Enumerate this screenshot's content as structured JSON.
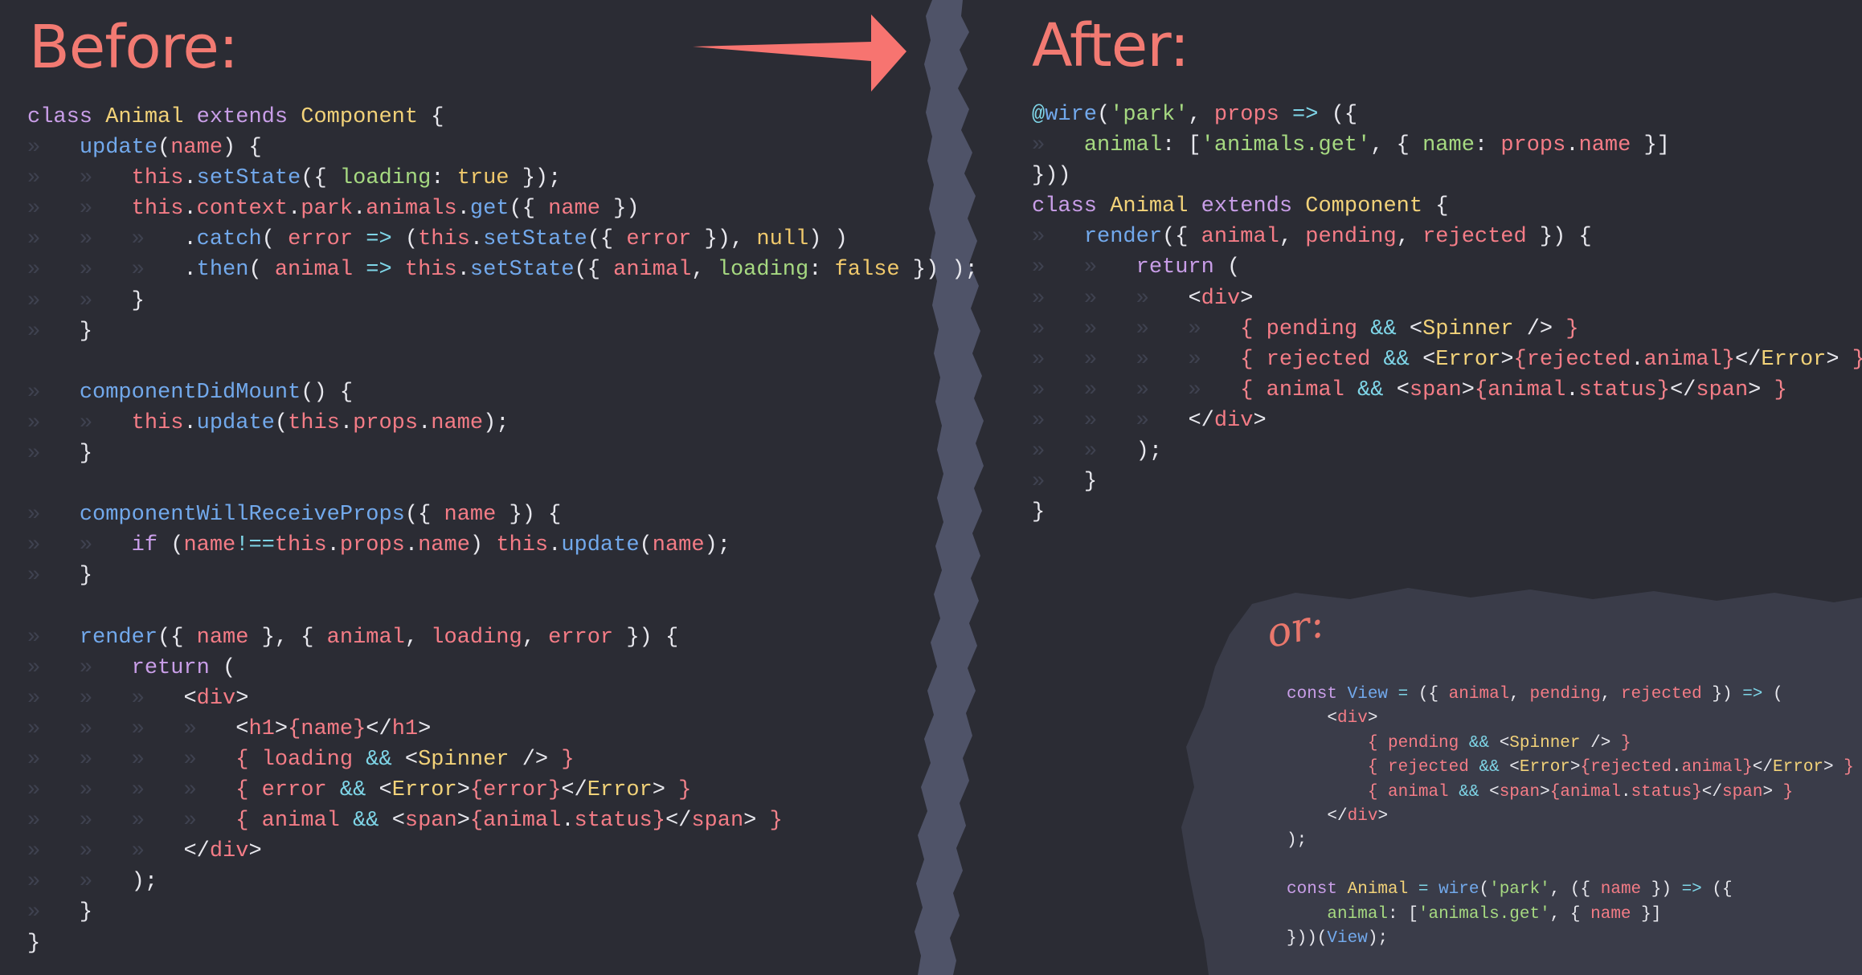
{
  "headings": {
    "before": "Before:",
    "after": "After:",
    "or": "or:"
  },
  "colors": {
    "background": "#2b2c34",
    "tear_strip": "#4f5368",
    "alt_panel": "#3a3c49",
    "heading": "#f27a72",
    "arrow": "#f77470",
    "keyword": "#c99ee8",
    "function": "#72a9ec",
    "class_name": "#f2d279",
    "parameter": "#f47c86",
    "string": "#a6d981",
    "operator": "#7fd6e8"
  },
  "icons": {
    "arrow": "right-arrow-icon"
  },
  "before_code": [
    [
      [
        "kw",
        "class "
      ],
      [
        "cls",
        "Animal "
      ],
      [
        "kw",
        "extends "
      ],
      [
        "cls",
        "Component"
      ],
      [
        "pl",
        " {"
      ]
    ],
    [
      [
        "i",
        "    "
      ],
      [
        "fn",
        "update"
      ],
      [
        "pl",
        "("
      ],
      [
        "prm",
        "name"
      ],
      [
        "pl",
        ") {"
      ]
    ],
    [
      [
        "i",
        "    "
      ],
      [
        "i",
        "    "
      ],
      [
        "prm",
        "this"
      ],
      [
        "pl",
        "."
      ],
      [
        "fn",
        "setState"
      ],
      [
        "pl",
        "({ "
      ],
      [
        "str",
        "loading"
      ],
      [
        "pl",
        ": "
      ],
      [
        "con",
        "true"
      ],
      [
        "pl",
        " });"
      ]
    ],
    [
      [
        "i",
        "    "
      ],
      [
        "i",
        "    "
      ],
      [
        "prm",
        "this"
      ],
      [
        "pl",
        "."
      ],
      [
        "prm",
        "context"
      ],
      [
        "pl",
        "."
      ],
      [
        "prm",
        "park"
      ],
      [
        "pl",
        "."
      ],
      [
        "prm",
        "animals"
      ],
      [
        "pl",
        "."
      ],
      [
        "fn",
        "get"
      ],
      [
        "pl",
        "({ "
      ],
      [
        "prm",
        "name"
      ],
      [
        "pl",
        " })"
      ]
    ],
    [
      [
        "i",
        "    "
      ],
      [
        "i",
        "    "
      ],
      [
        "i",
        "    "
      ],
      [
        "pl",
        "."
      ],
      [
        "fn",
        "catch"
      ],
      [
        "pl",
        "( "
      ],
      [
        "prm",
        "error"
      ],
      [
        "op",
        " => "
      ],
      [
        "pl",
        "("
      ],
      [
        "prm",
        "this"
      ],
      [
        "pl",
        "."
      ],
      [
        "fn",
        "setState"
      ],
      [
        "pl",
        "({ "
      ],
      [
        "prm",
        "error"
      ],
      [
        "pl",
        " }), "
      ],
      [
        "con",
        "null"
      ],
      [
        "pl",
        ") )"
      ]
    ],
    [
      [
        "i",
        "    "
      ],
      [
        "i",
        "    "
      ],
      [
        "i",
        "    "
      ],
      [
        "pl",
        "."
      ],
      [
        "fn",
        "then"
      ],
      [
        "pl",
        "( "
      ],
      [
        "prm",
        "animal"
      ],
      [
        "op",
        " => "
      ],
      [
        "prm",
        "this"
      ],
      [
        "pl",
        "."
      ],
      [
        "fn",
        "setState"
      ],
      [
        "pl",
        "({ "
      ],
      [
        "prm",
        "animal"
      ],
      [
        "pl",
        ", "
      ],
      [
        "str",
        "loading"
      ],
      [
        "pl",
        ": "
      ],
      [
        "con",
        "false"
      ],
      [
        "pl",
        " }) );"
      ]
    ],
    [
      [
        "i",
        "    "
      ],
      [
        "i",
        "    "
      ],
      [
        "pl",
        "}"
      ]
    ],
    [
      [
        "i",
        "    "
      ],
      [
        "pl",
        "}"
      ]
    ],
    [],
    [
      [
        "i",
        "    "
      ],
      [
        "fn",
        "componentDidMount"
      ],
      [
        "pl",
        "() {"
      ]
    ],
    [
      [
        "i",
        "    "
      ],
      [
        "i",
        "    "
      ],
      [
        "prm",
        "this"
      ],
      [
        "pl",
        "."
      ],
      [
        "fn",
        "update"
      ],
      [
        "pl",
        "("
      ],
      [
        "prm",
        "this"
      ],
      [
        "pl",
        "."
      ],
      [
        "prm",
        "props"
      ],
      [
        "pl",
        "."
      ],
      [
        "prm",
        "name"
      ],
      [
        "pl",
        ");"
      ]
    ],
    [
      [
        "i",
        "    "
      ],
      [
        "pl",
        "}"
      ]
    ],
    [],
    [
      [
        "i",
        "    "
      ],
      [
        "fn",
        "componentWillReceiveProps"
      ],
      [
        "pl",
        "({ "
      ],
      [
        "prm",
        "name"
      ],
      [
        "pl",
        " }) {"
      ]
    ],
    [
      [
        "i",
        "    "
      ],
      [
        "i",
        "    "
      ],
      [
        "kw",
        "if"
      ],
      [
        "pl",
        " ("
      ],
      [
        "prm",
        "name"
      ],
      [
        "op",
        "!=="
      ],
      [
        "prm",
        "this"
      ],
      [
        "pl",
        "."
      ],
      [
        "prm",
        "props"
      ],
      [
        "pl",
        "."
      ],
      [
        "prm",
        "name"
      ],
      [
        "pl",
        ") "
      ],
      [
        "prm",
        "this"
      ],
      [
        "pl",
        "."
      ],
      [
        "fn",
        "update"
      ],
      [
        "pl",
        "("
      ],
      [
        "prm",
        "name"
      ],
      [
        "pl",
        ");"
      ]
    ],
    [
      [
        "i",
        "    "
      ],
      [
        "pl",
        "}"
      ]
    ],
    [],
    [
      [
        "i",
        "    "
      ],
      [
        "fn",
        "render"
      ],
      [
        "pl",
        "({ "
      ],
      [
        "prm",
        "name"
      ],
      [
        "pl",
        " }, { "
      ],
      [
        "prm",
        "animal"
      ],
      [
        "pl",
        ", "
      ],
      [
        "prm",
        "loading"
      ],
      [
        "pl",
        ", "
      ],
      [
        "prm",
        "error"
      ],
      [
        "pl",
        " }) {"
      ]
    ],
    [
      [
        "i",
        "    "
      ],
      [
        "i",
        "    "
      ],
      [
        "kw",
        "return"
      ],
      [
        "pl",
        " ("
      ]
    ],
    [
      [
        "i",
        "    "
      ],
      [
        "i",
        "    "
      ],
      [
        "i",
        "    "
      ],
      [
        "pl",
        "<"
      ],
      [
        "tag",
        "div"
      ],
      [
        "pl",
        ">"
      ]
    ],
    [
      [
        "i",
        "    "
      ],
      [
        "i",
        "    "
      ],
      [
        "i",
        "    "
      ],
      [
        "i",
        "    "
      ],
      [
        "pl",
        "<"
      ],
      [
        "tag",
        "h1"
      ],
      [
        "pl",
        ">"
      ],
      [
        "br",
        "{"
      ],
      [
        "prm",
        "name"
      ],
      [
        "br",
        "}"
      ],
      [
        "pl",
        "</"
      ],
      [
        "tag",
        "h1"
      ],
      [
        "pl",
        ">"
      ]
    ],
    [
      [
        "i",
        "    "
      ],
      [
        "i",
        "    "
      ],
      [
        "i",
        "    "
      ],
      [
        "i",
        "    "
      ],
      [
        "br",
        "{ "
      ],
      [
        "prm",
        "loading "
      ],
      [
        "op",
        "&& "
      ],
      [
        "pl",
        "<"
      ],
      [
        "cmp",
        "Spinner"
      ],
      [
        "pl",
        " /> "
      ],
      [
        "br",
        "}"
      ]
    ],
    [
      [
        "i",
        "    "
      ],
      [
        "i",
        "    "
      ],
      [
        "i",
        "    "
      ],
      [
        "i",
        "    "
      ],
      [
        "br",
        "{ "
      ],
      [
        "prm",
        "error "
      ],
      [
        "op",
        "&& "
      ],
      [
        "pl",
        "<"
      ],
      [
        "cmp",
        "Error"
      ],
      [
        "pl",
        ">"
      ],
      [
        "br",
        "{"
      ],
      [
        "prm",
        "error"
      ],
      [
        "br",
        "}"
      ],
      [
        "pl",
        "</"
      ],
      [
        "cmp",
        "Error"
      ],
      [
        "pl",
        "> "
      ],
      [
        "br",
        "}"
      ]
    ],
    [
      [
        "i",
        "    "
      ],
      [
        "i",
        "    "
      ],
      [
        "i",
        "    "
      ],
      [
        "i",
        "    "
      ],
      [
        "br",
        "{ "
      ],
      [
        "prm",
        "animal "
      ],
      [
        "op",
        "&& "
      ],
      [
        "pl",
        "<"
      ],
      [
        "tag",
        "span"
      ],
      [
        "pl",
        ">"
      ],
      [
        "br",
        "{"
      ],
      [
        "prm",
        "animal"
      ],
      [
        "pl",
        "."
      ],
      [
        "prm",
        "status"
      ],
      [
        "br",
        "}"
      ],
      [
        "pl",
        "</"
      ],
      [
        "tag",
        "span"
      ],
      [
        "pl",
        "> "
      ],
      [
        "br",
        "}"
      ]
    ],
    [
      [
        "i",
        "    "
      ],
      [
        "i",
        "    "
      ],
      [
        "i",
        "    "
      ],
      [
        "pl",
        "</"
      ],
      [
        "tag",
        "div"
      ],
      [
        "pl",
        ">"
      ]
    ],
    [
      [
        "i",
        "    "
      ],
      [
        "i",
        "    "
      ],
      [
        "pl",
        ");"
      ]
    ],
    [
      [
        "i",
        "    "
      ],
      [
        "pl",
        "}"
      ]
    ],
    [
      [
        "pl",
        "}"
      ]
    ]
  ],
  "after_code": [
    [
      [
        "op",
        "@"
      ],
      [
        "fn",
        "wire"
      ],
      [
        "pl",
        "("
      ],
      [
        "str",
        "'park'"
      ],
      [
        "pl",
        ", "
      ],
      [
        "prm",
        "props"
      ],
      [
        "op",
        " => "
      ],
      [
        "pl",
        "({"
      ]
    ],
    [
      [
        "i",
        "    "
      ],
      [
        "str",
        "animal"
      ],
      [
        "pl",
        ": ["
      ],
      [
        "str",
        "'animals.get'"
      ],
      [
        "pl",
        ", { "
      ],
      [
        "str",
        "name"
      ],
      [
        "pl",
        ": "
      ],
      [
        "prm",
        "props"
      ],
      [
        "pl",
        "."
      ],
      [
        "prm",
        "name"
      ],
      [
        "pl",
        " }]"
      ]
    ],
    [
      [
        "pl",
        "}))"
      ]
    ],
    [
      [
        "kw",
        "class "
      ],
      [
        "cls",
        "Animal "
      ],
      [
        "kw",
        "extends "
      ],
      [
        "cls",
        "Component"
      ],
      [
        "pl",
        " {"
      ]
    ],
    [
      [
        "i",
        "    "
      ],
      [
        "fn",
        "render"
      ],
      [
        "pl",
        "({ "
      ],
      [
        "prm",
        "animal"
      ],
      [
        "pl",
        ", "
      ],
      [
        "prm",
        "pending"
      ],
      [
        "pl",
        ", "
      ],
      [
        "prm",
        "rejected"
      ],
      [
        "pl",
        " }) {"
      ]
    ],
    [
      [
        "i",
        "    "
      ],
      [
        "i",
        "    "
      ],
      [
        "kw",
        "return"
      ],
      [
        "pl",
        " ("
      ]
    ],
    [
      [
        "i",
        "    "
      ],
      [
        "i",
        "    "
      ],
      [
        "i",
        "    "
      ],
      [
        "pl",
        "<"
      ],
      [
        "tag",
        "div"
      ],
      [
        "pl",
        ">"
      ]
    ],
    [
      [
        "i",
        "    "
      ],
      [
        "i",
        "    "
      ],
      [
        "i",
        "    "
      ],
      [
        "i",
        "    "
      ],
      [
        "br",
        "{ "
      ],
      [
        "prm",
        "pending "
      ],
      [
        "op",
        "&& "
      ],
      [
        "pl",
        "<"
      ],
      [
        "cmp",
        "Spinner"
      ],
      [
        "pl",
        " /> "
      ],
      [
        "br",
        "}"
      ]
    ],
    [
      [
        "i",
        "    "
      ],
      [
        "i",
        "    "
      ],
      [
        "i",
        "    "
      ],
      [
        "i",
        "    "
      ],
      [
        "br",
        "{ "
      ],
      [
        "prm",
        "rejected "
      ],
      [
        "op",
        "&& "
      ],
      [
        "pl",
        "<"
      ],
      [
        "cmp",
        "Error"
      ],
      [
        "pl",
        ">"
      ],
      [
        "br",
        "{"
      ],
      [
        "prm",
        "rejected"
      ],
      [
        "pl",
        "."
      ],
      [
        "prm",
        "animal"
      ],
      [
        "br",
        "}"
      ],
      [
        "pl",
        "</"
      ],
      [
        "cmp",
        "Error"
      ],
      [
        "pl",
        "> "
      ],
      [
        "br",
        "}"
      ]
    ],
    [
      [
        "i",
        "    "
      ],
      [
        "i",
        "    "
      ],
      [
        "i",
        "    "
      ],
      [
        "i",
        "    "
      ],
      [
        "br",
        "{ "
      ],
      [
        "prm",
        "animal "
      ],
      [
        "op",
        "&& "
      ],
      [
        "pl",
        "<"
      ],
      [
        "tag",
        "span"
      ],
      [
        "pl",
        ">"
      ],
      [
        "br",
        "{"
      ],
      [
        "prm",
        "animal"
      ],
      [
        "pl",
        "."
      ],
      [
        "prm",
        "status"
      ],
      [
        "br",
        "}"
      ],
      [
        "pl",
        "</"
      ],
      [
        "tag",
        "span"
      ],
      [
        "pl",
        "> "
      ],
      [
        "br",
        "}"
      ]
    ],
    [
      [
        "i",
        "    "
      ],
      [
        "i",
        "    "
      ],
      [
        "i",
        "    "
      ],
      [
        "pl",
        "</"
      ],
      [
        "tag",
        "div"
      ],
      [
        "pl",
        ">"
      ]
    ],
    [
      [
        "i",
        "    "
      ],
      [
        "i",
        "    "
      ],
      [
        "pl",
        ");"
      ]
    ],
    [
      [
        "i",
        "    "
      ],
      [
        "pl",
        "}"
      ]
    ],
    [
      [
        "pl",
        "}"
      ]
    ]
  ],
  "alt_code": [
    [
      [
        "kw",
        "const "
      ],
      [
        "fn",
        "View"
      ],
      [
        "op",
        " = "
      ],
      [
        "pl",
        "({ "
      ],
      [
        "prm",
        "animal"
      ],
      [
        "pl",
        ", "
      ],
      [
        "prm",
        "pending"
      ],
      [
        "pl",
        ", "
      ],
      [
        "prm",
        "rejected"
      ],
      [
        "pl",
        " }) "
      ],
      [
        "op",
        "=>"
      ],
      [
        "pl",
        " ("
      ]
    ],
    [
      [
        "pl",
        "    <"
      ],
      [
        "tag",
        "div"
      ],
      [
        "pl",
        ">"
      ]
    ],
    [
      [
        "pl",
        "        "
      ],
      [
        "br",
        "{ "
      ],
      [
        "prm",
        "pending "
      ],
      [
        "op",
        "&& "
      ],
      [
        "pl",
        "<"
      ],
      [
        "cmp",
        "Spinner"
      ],
      [
        "pl",
        " /> "
      ],
      [
        "br",
        "}"
      ]
    ],
    [
      [
        "pl",
        "        "
      ],
      [
        "br",
        "{ "
      ],
      [
        "prm",
        "rejected "
      ],
      [
        "op",
        "&& "
      ],
      [
        "pl",
        "<"
      ],
      [
        "cmp",
        "Error"
      ],
      [
        "pl",
        ">"
      ],
      [
        "br",
        "{"
      ],
      [
        "prm",
        "rejected"
      ],
      [
        "pl",
        "."
      ],
      [
        "prm",
        "animal"
      ],
      [
        "br",
        "}"
      ],
      [
        "pl",
        "</"
      ],
      [
        "cmp",
        "Error"
      ],
      [
        "pl",
        "> "
      ],
      [
        "br",
        "}"
      ]
    ],
    [
      [
        "pl",
        "        "
      ],
      [
        "br",
        "{ "
      ],
      [
        "prm",
        "animal "
      ],
      [
        "op",
        "&& "
      ],
      [
        "pl",
        "<"
      ],
      [
        "tag",
        "span"
      ],
      [
        "pl",
        ">"
      ],
      [
        "br",
        "{"
      ],
      [
        "prm",
        "animal"
      ],
      [
        "pl",
        "."
      ],
      [
        "prm",
        "status"
      ],
      [
        "br",
        "}"
      ],
      [
        "pl",
        "</"
      ],
      [
        "tag",
        "span"
      ],
      [
        "pl",
        "> "
      ],
      [
        "br",
        "}"
      ]
    ],
    [
      [
        "pl",
        "    </"
      ],
      [
        "tag",
        "div"
      ],
      [
        "pl",
        ">"
      ]
    ],
    [
      [
        "pl",
        ");"
      ]
    ],
    [],
    [
      [
        "kw",
        "const "
      ],
      [
        "cls",
        "Animal"
      ],
      [
        "op",
        " = "
      ],
      [
        "fn",
        "wire"
      ],
      [
        "pl",
        "("
      ],
      [
        "str",
        "'park'"
      ],
      [
        "pl",
        ", ({ "
      ],
      [
        "prm",
        "name"
      ],
      [
        "pl",
        " }) "
      ],
      [
        "op",
        "=>"
      ],
      [
        "pl",
        " ({"
      ]
    ],
    [
      [
        "pl",
        "    "
      ],
      [
        "str",
        "animal"
      ],
      [
        "pl",
        ": ["
      ],
      [
        "str",
        "'animals.get'"
      ],
      [
        "pl",
        ", { "
      ],
      [
        "prm",
        "name"
      ],
      [
        "pl",
        " }]"
      ]
    ],
    [
      [
        "pl",
        "}))("
      ],
      [
        "fn",
        "View"
      ],
      [
        "pl",
        ");"
      ]
    ]
  ]
}
